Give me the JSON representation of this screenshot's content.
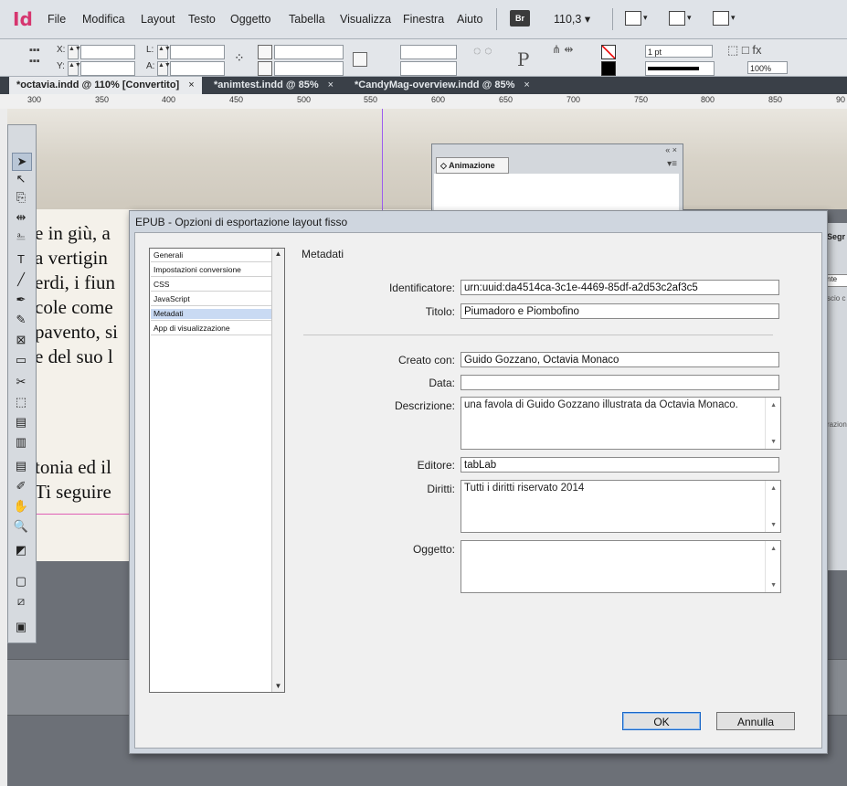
{
  "app": {
    "logo": "Id",
    "menu": [
      "File",
      "Modifica",
      "Layout",
      "Testo",
      "Oggetto",
      "Tabella",
      "Visualizza",
      "Finestra",
      "Aiuto"
    ],
    "bridge_badge": "Br",
    "zoom": "110,3"
  },
  "control_panel": {
    "x_label": "X:",
    "y_label": "Y:",
    "w_label": "L:",
    "h_label": "A:",
    "stroke_weight": "1 pt",
    "opacity": "100%"
  },
  "tabs": [
    {
      "label": "*octavia.indd @ 110% [Convertito]",
      "close": "×"
    },
    {
      "label": "*animtest.indd @ 85%",
      "close": "×"
    },
    {
      "label": "*CandyMag-overview.indd @ 85%",
      "close": "×"
    }
  ],
  "ruler": [
    "300",
    "350",
    "400",
    "450",
    "500",
    "550",
    "600",
    "650",
    "700",
    "750",
    "800",
    "850",
    "90"
  ],
  "story_lines": [
    "e in giù, a",
    "a vertigin",
    "erdi, i fiun",
    "cole come",
    "pavento, si",
    "e del suo l",
    "tonia ed il",
    "Ti seguire"
  ],
  "animation_panel": {
    "tab": "◇ Animazione"
  },
  "side_panel": {
    "fragments": [
      "Segr",
      "nte",
      "scio c",
      "razion"
    ]
  },
  "dialog": {
    "title": "EPUB - Opzioni di esportazione layout fisso",
    "nav": [
      "Generali",
      "Impostazioni conversione",
      "CSS",
      "JavaScript",
      "Metadati",
      "App di visualizzazione"
    ],
    "section_heading": "Metadati",
    "fields": {
      "identifier_label": "Identificatore:",
      "identifier_value": "urn:uuid:da4514ca-3c1e-4469-85df-a2d53c2af3c5",
      "title_label": "Titolo:",
      "title_value": "Piumadoro e Piombofino",
      "creator_label": "Creato con:",
      "creator_value": "Guido Gozzano, Octavia Monaco",
      "date_label": "Data:",
      "date_value": "",
      "description_label": "Descrizione:",
      "description_value": "una favola di Guido Gozzano illustrata da Octavia Monaco.",
      "publisher_label": "Editore:",
      "publisher_value": "tabLab",
      "rights_label": "Diritti:",
      "rights_value": "Tutti i diritti riservato 2014",
      "subject_label": "Oggetto:",
      "subject_value": ""
    },
    "ok_label": "OK",
    "cancel_label": "Annulla"
  }
}
